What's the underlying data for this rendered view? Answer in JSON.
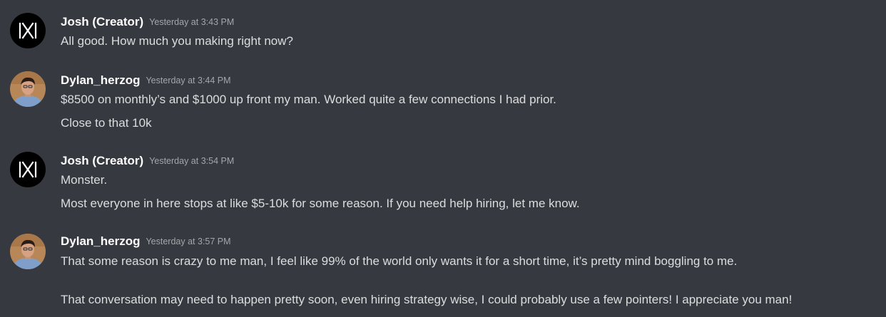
{
  "messages": [
    {
      "author": "Josh (Creator)",
      "timestamp": "Yesterday at 3:43 PM",
      "avatar": "creator-logo",
      "lines": [
        "All good. How much you making right now?"
      ]
    },
    {
      "author": "Dylan_herzog",
      "timestamp": "Yesterday at 3:44 PM",
      "avatar": "user-photo",
      "lines": [
        "$8500 on monthly’s and $1000 up front my man. Worked quite a few connections I had prior.",
        "Close to that 10k"
      ]
    },
    {
      "author": "Josh (Creator)",
      "timestamp": "Yesterday at 3:54 PM",
      "avatar": "creator-logo",
      "lines": [
        "Monster.",
        "Most everyone in here stops at like $5-10k for some reason. If you need help hiring, let me know."
      ]
    },
    {
      "author": "Dylan_herzog",
      "timestamp": "Yesterday at 3:57 PM",
      "avatar": "user-photo",
      "lines": [
        "That some reason is crazy to me man, I feel like 99% of the world only wants it for a short time, it’s pretty mind boggling to me.",
        "That conversation may need to happen pretty soon, even hiring strategy wise, I could probably use a few pointers! I appreciate you man!"
      ]
    }
  ],
  "colors": {
    "background": "#36393f",
    "username": "#ffffff",
    "text": "#dcddde",
    "timestamp": "#a3a6aa"
  }
}
